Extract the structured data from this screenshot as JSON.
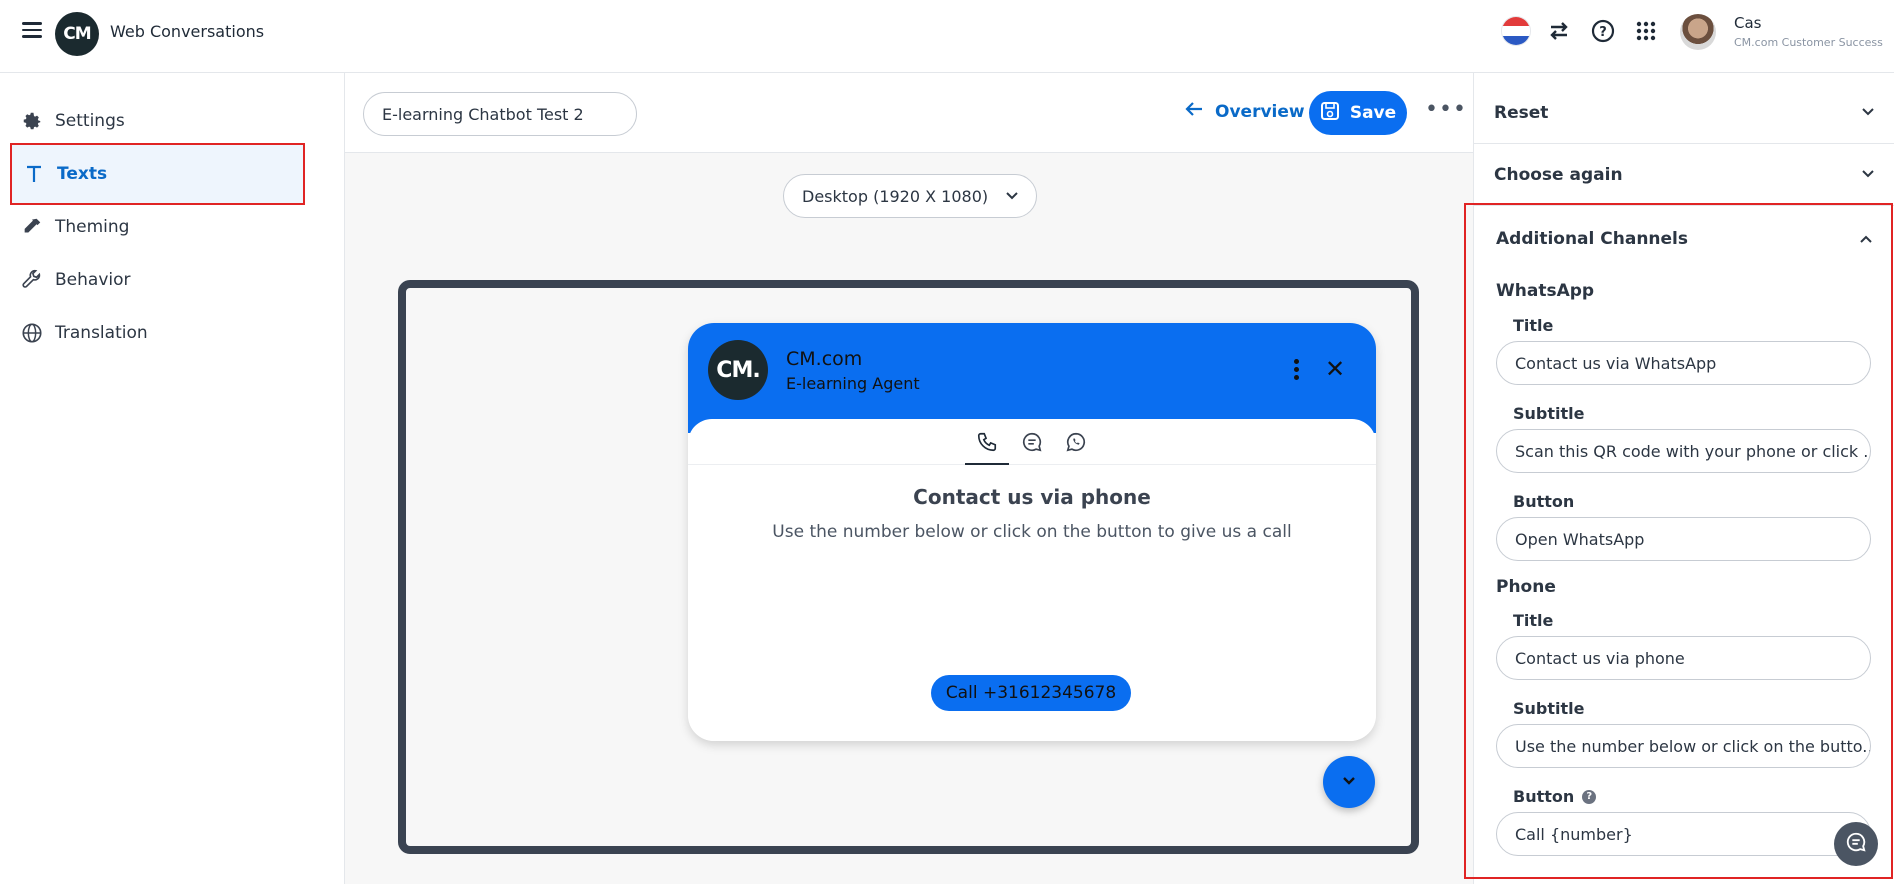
{
  "app": {
    "title": "Web Conversations",
    "logo_text": "CM"
  },
  "user": {
    "name": "Cas",
    "role": "CM.com Customer Success"
  },
  "topbar_icons": [
    "flag-nl-icon",
    "switch-arrows-icon",
    "help-icon",
    "apps-grid-icon"
  ],
  "nav": {
    "items": [
      {
        "label": "Settings",
        "icon": "gear-icon"
      },
      {
        "label": "Texts",
        "icon": "text-icon",
        "active": true
      },
      {
        "label": "Theming",
        "icon": "eyedropper-icon"
      },
      {
        "label": "Behavior",
        "icon": "wrench-icon"
      },
      {
        "label": "Translation",
        "icon": "globe-icon"
      }
    ]
  },
  "editor": {
    "name_value": "E-learning Chatbot Test 2",
    "overview_label": "Overview",
    "save_label": "Save",
    "more_label": "•••",
    "device_value": "Desktop (1920 X 1080)"
  },
  "widget": {
    "logo_text": "CM.",
    "title": "CM.com",
    "agent": "E-learning Agent",
    "close": "✕",
    "content_title": "Contact us via phone",
    "content_subtitle": "Use the number below or click on the button to give us a call",
    "call_button": "Call +31612345678"
  },
  "panel": {
    "reset_label": "Reset",
    "choose_again_label": "Choose again",
    "channels_label": "Additional Channels",
    "whatsapp": {
      "group_label": "WhatsApp",
      "title_label": "Title",
      "title_value": "Contact us via WhatsApp",
      "subtitle_label": "Subtitle",
      "subtitle_value": "Scan this QR code with your phone or click ...",
      "button_label": "Button",
      "button_value": "Open WhatsApp"
    },
    "phone": {
      "group_label": "Phone",
      "title_label": "Title",
      "title_value": "Contact us via phone",
      "subtitle_label": "Subtitle",
      "subtitle_value": "Use the number below or click on the butto...",
      "button_label": "Button",
      "help": "?",
      "button_value": "Call {number}"
    }
  },
  "colors": {
    "accent": "#0a6ef0",
    "highlight": "#e02424",
    "dark": "#1b2a2f"
  }
}
